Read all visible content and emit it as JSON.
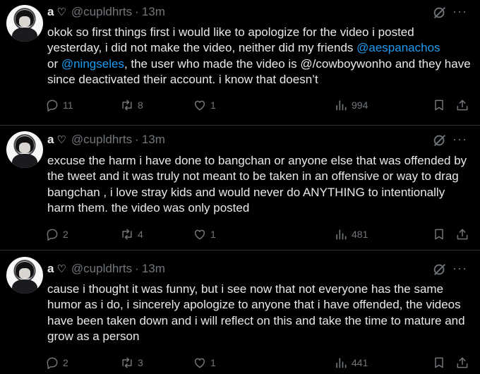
{
  "tweets": [
    {
      "author": "a",
      "heart": "♡",
      "handle": "@cupldhrts",
      "separator": "·",
      "time": "13m",
      "text_parts": [
        "okok so first things first i would like to apologize for the video i posted yesterday, i did not make the video, neither did my friends ",
        "@aespanachos",
        "\nor ",
        "@ningseles",
        ", the user who made the video is @/cowboywonho and they have since deactivated their account. i know that doesn’t"
      ],
      "replies": "11",
      "reposts": "8",
      "likes": "1",
      "views": "994"
    },
    {
      "author": "a",
      "heart": "♡",
      "handle": "@cupldhrts",
      "separator": "·",
      "time": "13m",
      "text": "excuse the harm i have done to bangchan or anyone else that was offended by the tweet and it was truly not meant to be taken in an offensive or way to drag bangchan , i love stray kids and would never do ANYTHING to intentionally harm them. the video was only posted",
      "replies": "2",
      "reposts": "4",
      "likes": "1",
      "views": "481"
    },
    {
      "author": "a",
      "heart": "♡",
      "handle": "@cupldhrts",
      "separator": "·",
      "time": "13m",
      "text": "cause i thought it was funny, but i see now that not everyone has the same humor as i do, i sincerely apologize to anyone that i have offended, the videos have been taken down and i will reflect on this and take the time to mature and grow as a person",
      "replies": "2",
      "reposts": "3",
      "likes": "1",
      "views": "441"
    }
  ],
  "more_glyph": "···",
  "icons": [
    "reply-icon",
    "repost-icon",
    "like-icon",
    "views-icon",
    "bookmark-icon",
    "share-icon",
    "grok-icon",
    "more-icon"
  ],
  "colors": {
    "background": "#000000",
    "text": "#e7e9ea",
    "muted": "#71767b",
    "link": "#1d9bf0",
    "divider": "#2f3336"
  }
}
